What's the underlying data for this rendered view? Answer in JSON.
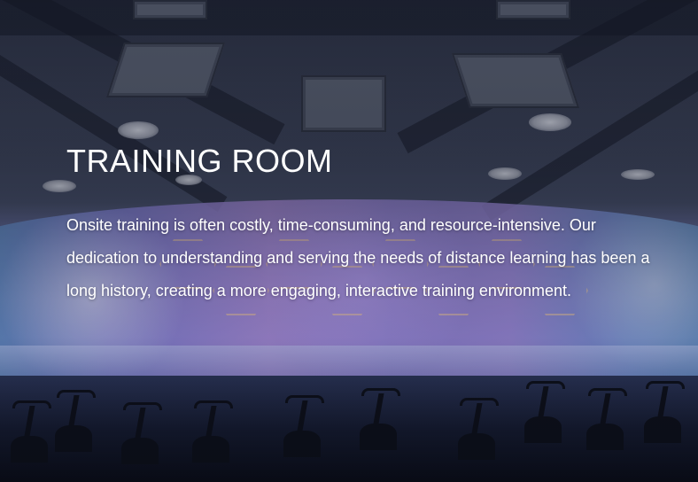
{
  "hero": {
    "title": "TRAINING ROOM",
    "description": "Onsite training is often costly, time-consuming, and resource-intensive. Our dedication to understanding and serving the needs of distance learning has been a long history, creating a more engaging, interactive training environment."
  },
  "colors": {
    "text": "#ffffff",
    "screen_accent": "#8a86c6",
    "ceiling": "#2a3043"
  }
}
